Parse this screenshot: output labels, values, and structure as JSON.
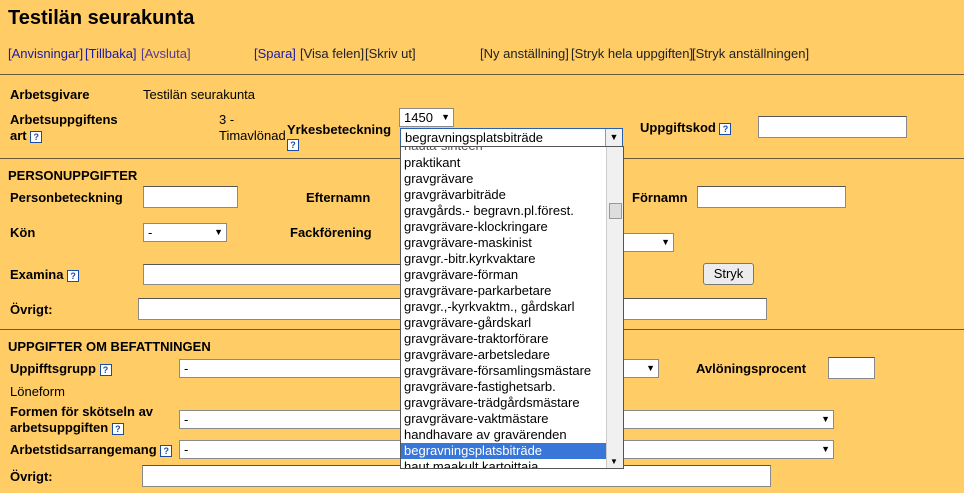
{
  "header": {
    "title": "Testilän seurakunta"
  },
  "nav": {
    "anvisningar": "[Anvisningar]",
    "tillbaka": "[Tillbaka]",
    "avsluta": "[Avsluta]",
    "spara": "[Spara]",
    "visa_felen": "[Visa felen]",
    "skriv_ut": "[Skriv ut]",
    "ny_anstallning": "[Ny anställning]",
    "stryk_uppgiften": "[Stryk hela uppgiften]",
    "stryk_anstallningen": "[Stryk anställningen]"
  },
  "employer": {
    "label": "Arbetsgivare",
    "value": "Testilän seurakunta",
    "task_type_label1": "Arbetsuppgiftens",
    "task_type_label2": "art",
    "task_type_value1": "3 -",
    "task_type_value2": "Timavlönad",
    "yrke_label": "Yrkesbeteckning",
    "yrke_code": "1450",
    "yrke_value": "begravningsplatsbiträde",
    "uppgiftskod_label": "Uppgiftskod"
  },
  "person": {
    "section_title": "PERSONUPPGIFTER",
    "personbeteckning_label": "Personbeteckning",
    "efternamn_label": "Efternamn",
    "fornamn_label": "Förnamn",
    "kon_label": "Kön",
    "kon_value": "-",
    "fackforening_label": "Fackförening",
    "examina_label": "Examina",
    "stryk_button": "Stryk",
    "ovrigt_label": "Övrigt:"
  },
  "befattning": {
    "section_title": "UPPGIFTER OM BEFATTNINGEN",
    "uppgiftsgrupp_label": "Uppifftsgrupp",
    "uppgiftsgrupp_value": "-",
    "avloningsprocent_label": "Avlöningsprocent",
    "loneform_label": "Löneform",
    "formen_label1": "Formen för skötseln av",
    "formen_label2": "arbetsuppgiften",
    "formen_value": "-",
    "arbetstid_label": "Arbetstidsarrangemang",
    "arbetstid_value": "-",
    "ovrigt_label": "Övrigt:"
  },
  "dropdown": {
    "partial_top": "hauta-sinteen",
    "items": [
      "praktikant",
      "gravgrävare",
      "gravgrävarbiträde",
      "gravgårds.- begravn.pl.förest.",
      "gravgrävare-klockringare",
      "gravgrävare-maskinist",
      "gravgr.-bitr.kyrkvaktare",
      "gravgrävare-förman",
      "gravgrävare-parkarbetare",
      "gravgr.,-kyrkvaktm., gårdskarl",
      "gravgrävare-gårdskarl",
      "gravgrävare-traktorförare",
      "gravgrävare-arbetsledare",
      "gravgrävare-församlingsmästare",
      "gravgrävare-fastighetsarb.",
      "gravgrävare-trädgårdsmästare",
      "gravgrävare-vaktmästare",
      "handhavare av gravärenden",
      "begravningsplatsbiträde",
      "haut.maakult.kartoittaja"
    ]
  },
  "icons": {
    "help": "help-icon",
    "dropdown_arrow": "chevron-down-icon"
  },
  "colors": {
    "background": "#ffcc66",
    "selection": "#3876d8",
    "link": "#1a1aa6"
  }
}
